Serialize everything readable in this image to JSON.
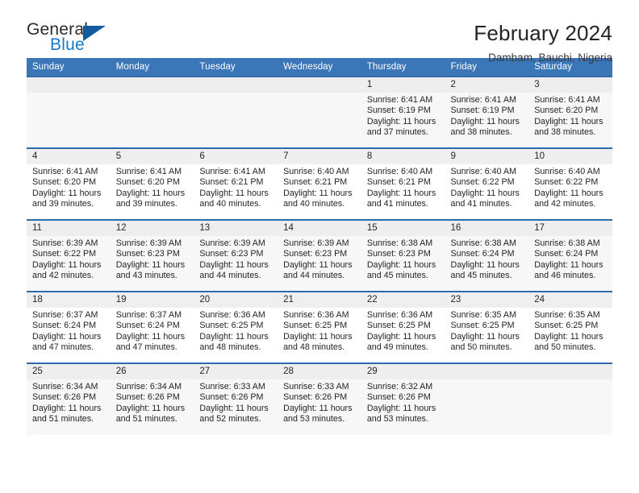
{
  "brand": {
    "word_one": "General",
    "word_two": "Blue",
    "triangle_icon": "triangle-icon",
    "accent_blue": "#1878c8",
    "logo_dark": "#2b2b2b"
  },
  "header": {
    "title": "February 2024",
    "subtitle": "Dambam, Bauchi, Nigeria"
  },
  "theme": {
    "header_row_bg": "#3a76b8",
    "row_border": "#2e6bab",
    "daynum_bg": "#efefef",
    "shaded_row_bg": "#f7f7f7"
  },
  "calendar": {
    "weekday_headers": [
      "Sunday",
      "Monday",
      "Tuesday",
      "Wednesday",
      "Thursday",
      "Friday",
      "Saturday"
    ],
    "weeks": [
      [
        {
          "day": "",
          "lines": []
        },
        {
          "day": "",
          "lines": []
        },
        {
          "day": "",
          "lines": []
        },
        {
          "day": "",
          "lines": []
        },
        {
          "day": "1",
          "lines": [
            "Sunrise: 6:41 AM",
            "Sunset: 6:19 PM",
            "Daylight: 11 hours",
            "and 37 minutes."
          ]
        },
        {
          "day": "2",
          "lines": [
            "Sunrise: 6:41 AM",
            "Sunset: 6:19 PM",
            "Daylight: 11 hours",
            "and 38 minutes."
          ]
        },
        {
          "day": "3",
          "lines": [
            "Sunrise: 6:41 AM",
            "Sunset: 6:20 PM",
            "Daylight: 11 hours",
            "and 38 minutes."
          ]
        }
      ],
      [
        {
          "day": "4",
          "lines": [
            "Sunrise: 6:41 AM",
            "Sunset: 6:20 PM",
            "Daylight: 11 hours",
            "and 39 minutes."
          ]
        },
        {
          "day": "5",
          "lines": [
            "Sunrise: 6:41 AM",
            "Sunset: 6:20 PM",
            "Daylight: 11 hours",
            "and 39 minutes."
          ]
        },
        {
          "day": "6",
          "lines": [
            "Sunrise: 6:41 AM",
            "Sunset: 6:21 PM",
            "Daylight: 11 hours",
            "and 40 minutes."
          ]
        },
        {
          "day": "7",
          "lines": [
            "Sunrise: 6:40 AM",
            "Sunset: 6:21 PM",
            "Daylight: 11 hours",
            "and 40 minutes."
          ]
        },
        {
          "day": "8",
          "lines": [
            "Sunrise: 6:40 AM",
            "Sunset: 6:21 PM",
            "Daylight: 11 hours",
            "and 41 minutes."
          ]
        },
        {
          "day": "9",
          "lines": [
            "Sunrise: 6:40 AM",
            "Sunset: 6:22 PM",
            "Daylight: 11 hours",
            "and 41 minutes."
          ]
        },
        {
          "day": "10",
          "lines": [
            "Sunrise: 6:40 AM",
            "Sunset: 6:22 PM",
            "Daylight: 11 hours",
            "and 42 minutes."
          ]
        }
      ],
      [
        {
          "day": "11",
          "lines": [
            "Sunrise: 6:39 AM",
            "Sunset: 6:22 PM",
            "Daylight: 11 hours",
            "and 42 minutes."
          ]
        },
        {
          "day": "12",
          "lines": [
            "Sunrise: 6:39 AM",
            "Sunset: 6:23 PM",
            "Daylight: 11 hours",
            "and 43 minutes."
          ]
        },
        {
          "day": "13",
          "lines": [
            "Sunrise: 6:39 AM",
            "Sunset: 6:23 PM",
            "Daylight: 11 hours",
            "and 44 minutes."
          ]
        },
        {
          "day": "14",
          "lines": [
            "Sunrise: 6:39 AM",
            "Sunset: 6:23 PM",
            "Daylight: 11 hours",
            "and 44 minutes."
          ]
        },
        {
          "day": "15",
          "lines": [
            "Sunrise: 6:38 AM",
            "Sunset: 6:23 PM",
            "Daylight: 11 hours",
            "and 45 minutes."
          ]
        },
        {
          "day": "16",
          "lines": [
            "Sunrise: 6:38 AM",
            "Sunset: 6:24 PM",
            "Daylight: 11 hours",
            "and 45 minutes."
          ]
        },
        {
          "day": "17",
          "lines": [
            "Sunrise: 6:38 AM",
            "Sunset: 6:24 PM",
            "Daylight: 11 hours",
            "and 46 minutes."
          ]
        }
      ],
      [
        {
          "day": "18",
          "lines": [
            "Sunrise: 6:37 AM",
            "Sunset: 6:24 PM",
            "Daylight: 11 hours",
            "and 47 minutes."
          ]
        },
        {
          "day": "19",
          "lines": [
            "Sunrise: 6:37 AM",
            "Sunset: 6:24 PM",
            "Daylight: 11 hours",
            "and 47 minutes."
          ]
        },
        {
          "day": "20",
          "lines": [
            "Sunrise: 6:36 AM",
            "Sunset: 6:25 PM",
            "Daylight: 11 hours",
            "and 48 minutes."
          ]
        },
        {
          "day": "21",
          "lines": [
            "Sunrise: 6:36 AM",
            "Sunset: 6:25 PM",
            "Daylight: 11 hours",
            "and 48 minutes."
          ]
        },
        {
          "day": "22",
          "lines": [
            "Sunrise: 6:36 AM",
            "Sunset: 6:25 PM",
            "Daylight: 11 hours",
            "and 49 minutes."
          ]
        },
        {
          "day": "23",
          "lines": [
            "Sunrise: 6:35 AM",
            "Sunset: 6:25 PM",
            "Daylight: 11 hours",
            "and 50 minutes."
          ]
        },
        {
          "day": "24",
          "lines": [
            "Sunrise: 6:35 AM",
            "Sunset: 6:25 PM",
            "Daylight: 11 hours",
            "and 50 minutes."
          ]
        }
      ],
      [
        {
          "day": "25",
          "lines": [
            "Sunrise: 6:34 AM",
            "Sunset: 6:26 PM",
            "Daylight: 11 hours",
            "and 51 minutes."
          ]
        },
        {
          "day": "26",
          "lines": [
            "Sunrise: 6:34 AM",
            "Sunset: 6:26 PM",
            "Daylight: 11 hours",
            "and 51 minutes."
          ]
        },
        {
          "day": "27",
          "lines": [
            "Sunrise: 6:33 AM",
            "Sunset: 6:26 PM",
            "Daylight: 11 hours",
            "and 52 minutes."
          ]
        },
        {
          "day": "28",
          "lines": [
            "Sunrise: 6:33 AM",
            "Sunset: 6:26 PM",
            "Daylight: 11 hours",
            "and 53 minutes."
          ]
        },
        {
          "day": "29",
          "lines": [
            "Sunrise: 6:32 AM",
            "Sunset: 6:26 PM",
            "Daylight: 11 hours",
            "and 53 minutes."
          ]
        },
        {
          "day": "",
          "lines": []
        },
        {
          "day": "",
          "lines": []
        }
      ]
    ]
  }
}
